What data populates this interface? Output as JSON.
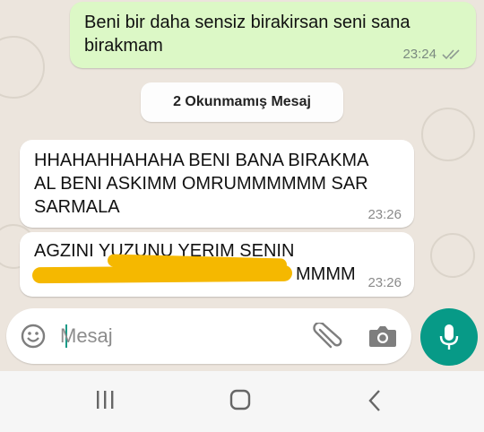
{
  "messages": [
    {
      "direction": "out",
      "text_line1": "Beni bir daha sensiz birakirsan seni sana",
      "text_line2": "birakmam",
      "time": "23:24"
    },
    {
      "direction": "in",
      "text_line1": "HHAHAHHAHAHA BENI BANA BIRAKMA",
      "text_line2": "AL BENI ASKIMM OMRUMMMMMM SAR",
      "text_line3": "SARMALA",
      "time": "23:26"
    },
    {
      "direction": "in",
      "text_line1": "AGZINI YUZUNU YERIM SENIN",
      "text_line2_visible": "MMMM",
      "time": "23:26"
    }
  ],
  "unread_divider": "2 Okunmamış Mesaj",
  "composer": {
    "placeholder": "Mesaj"
  },
  "icons": {
    "emoji": "emoji-icon",
    "attach": "paperclip-icon",
    "camera": "camera-icon",
    "mic": "mic-icon",
    "read_receipt": "double-check-icon",
    "nav_recents": "recents-icon",
    "nav_home": "home-icon",
    "nav_back": "back-icon"
  },
  "colors": {
    "outgoing_bubble": "#dcf8c6",
    "incoming_bubble": "#ffffff",
    "chat_background": "#ece5dd",
    "accent": "#079a87",
    "redaction": "#f5b800"
  }
}
